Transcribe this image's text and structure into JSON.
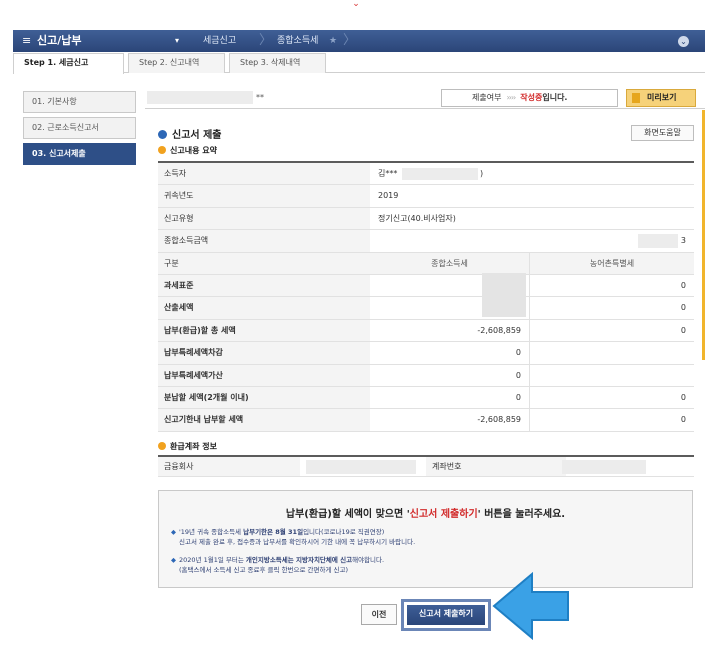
{
  "top_mark": "⌄",
  "topbar": {
    "app_title": "신고/납부",
    "breadcrumb": [
      "세금신고",
      "종합소득세"
    ],
    "breadcrumb_sep": "〉",
    "arrow": "▾",
    "star": "★",
    "hamburger": "≡",
    "settings_glyph": "⌄"
  },
  "steps": [
    {
      "label": "Step 1. 세금신고",
      "active": true
    },
    {
      "label": "Step 2. 신고내역",
      "active": false
    },
    {
      "label": "Step 3. 삭제내역",
      "active": false
    }
  ],
  "sidebar": [
    {
      "label": "01. 기본사항",
      "active": false
    },
    {
      "label": "02. 근로소득신고서",
      "active": false
    },
    {
      "label": "03. 신고서제출",
      "active": true
    }
  ],
  "header": {
    "star_mark": "**",
    "submit_label": "제출여부",
    "arrows": "››››",
    "status": "작성중",
    "status_suffix": "입니다.",
    "preview_button": "미리보기"
  },
  "section": {
    "title": "신고서 제출",
    "help_button": "화면도움말",
    "summary_title": "신고내용 요약",
    "account_title": "환급계좌 정보"
  },
  "summary": {
    "rows_basic": [
      {
        "label": "소득자",
        "value": "김***",
        "tail": ")"
      },
      {
        "label": "귀속년도",
        "value": "2019"
      },
      {
        "label": "신고유형",
        "value": "정기신고(40.비사업자)"
      },
      {
        "label": "종합소득금액",
        "value": "",
        "tail3": "3"
      }
    ],
    "header": {
      "label": "구분",
      "col1": "종합소득세",
      "col2": "농어촌특별세"
    },
    "rows_tax": [
      {
        "label": "과세표준",
        "col1": "",
        "col2": "0"
      },
      {
        "label": "산출세액",
        "col1": "",
        "col2": "0"
      },
      {
        "label": "납부(환급)할 총 세액",
        "col1": "-2,608,859",
        "col2": "0"
      },
      {
        "label": "납부특례세액차감",
        "col1": "0",
        "col2": ""
      },
      {
        "label": "납부특례세액가산",
        "col1": "0",
        "col2": ""
      },
      {
        "label": "분납할 세액(2개월 이내)",
        "col1": "0",
        "col2": "0"
      },
      {
        "label": "신고기한내 납부할 세액",
        "col1": "-2,608,859",
        "col2": "0"
      }
    ]
  },
  "account": {
    "bank_label": "금융회사",
    "account_label": "계좌번호"
  },
  "notice": {
    "main_prefix": "납부(환급)할 세액이 맞으면 '",
    "main_highlight": "신고서 제출하기",
    "main_suffix": "' 버튼을 눌러주세요.",
    "bullet1_a": "'19년 귀속 종합소득세 ",
    "bullet1_b": "납부기한은 8월 31일",
    "bullet1_c": "입니다(코로나19로 직권연장)",
    "bullet1_line2": "신고서 제출 완료 후, 접수증과 납부서를 확인하시어 기한 내에 꼭 납부하시기 바랍니다.",
    "bullet2_a": "2020년 1월1일 부터는 ",
    "bullet2_b": "개인지방소득세는 지방자치단체에 신고",
    "bullet2_c": "해야합니다.",
    "bullet2_line2": "(홈택스에서 소득세 신고 종료후 클릭 한번으로 간편하게 신고)"
  },
  "buttons": {
    "prev": "이전",
    "submit": "신고서 제출하기"
  },
  "colors": {
    "accent": "#2e4f87",
    "status_red": "#d22b2b",
    "preview_yellow": "#f6d27a",
    "arrow_blue": "#3aa1e6"
  }
}
